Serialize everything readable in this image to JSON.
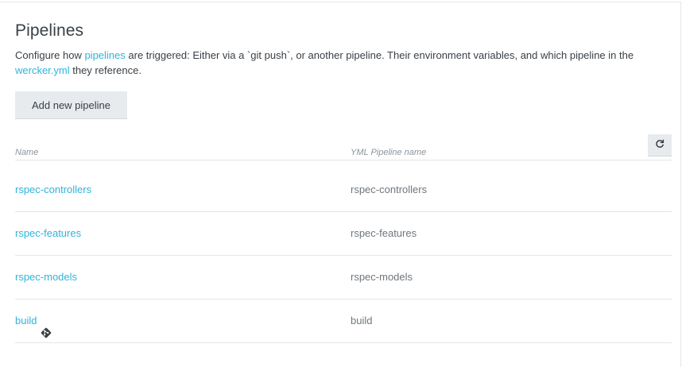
{
  "header": {
    "title": "Pipelines",
    "desc_part1": "Configure how ",
    "desc_link_pipelines": "pipelines",
    "desc_part2": " are triggered: Either via a `git push`, or another pipeline. Their environment variables, and which pipeline in the ",
    "desc_link_yml": "wercker.yml",
    "desc_part3": " they reference."
  },
  "actions": {
    "add_label": "Add new pipeline",
    "refresh_icon": "refresh-icon"
  },
  "table": {
    "columns": [
      "Name",
      "YML Pipeline name"
    ],
    "rows": [
      {
        "name": "rspec-controllers",
        "yml": "rspec-controllers",
        "icon": null
      },
      {
        "name": "rspec-features",
        "yml": "rspec-features",
        "icon": null
      },
      {
        "name": "rspec-models",
        "yml": "rspec-models",
        "icon": null
      },
      {
        "name": "build",
        "yml": "build",
        "icon": "git-icon"
      }
    ]
  },
  "colors": {
    "link": "#2fb4da",
    "text": "#3a4046",
    "muted": "#8c949b",
    "button_bg": "#e8ebee"
  }
}
